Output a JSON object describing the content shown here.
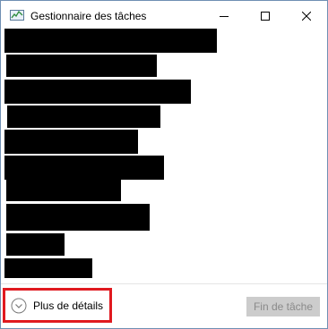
{
  "window": {
    "title": "Gestionnaire des tâches",
    "app_icon": "task-manager-icon",
    "controls": [
      "minimize-icon",
      "maximize-icon",
      "close-icon"
    ]
  },
  "process_list": {
    "redacted_rows": 10
  },
  "footer": {
    "details_label": "Plus de détails",
    "details_icon": "chevron-down-circle-icon",
    "end_task_label": "Fin de tâche",
    "end_task_enabled": false
  },
  "colors": {
    "highlight_border": "#e0191f",
    "window_border": "#6f8fb3",
    "disabled_button_bg": "#cccccc",
    "disabled_button_text": "#8a8a8a"
  }
}
